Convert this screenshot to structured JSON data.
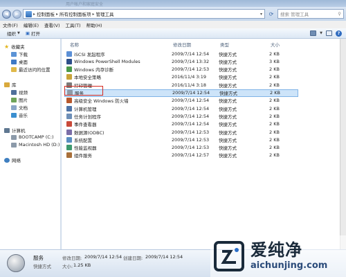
{
  "window": {
    "ghost_title": "用户帐户和家庭安全"
  },
  "address": {
    "crumbs": [
      "控制面板",
      "所有控制面板项",
      "管理工具"
    ],
    "search_placeholder": "搜索 管理工具"
  },
  "menu": [
    "文件(F)",
    "编辑(E)",
    "查看(V)",
    "工具(T)",
    "帮助(H)"
  ],
  "toolbar": {
    "organize": "组织",
    "open": "打开"
  },
  "nav": {
    "favorites": {
      "header": "收藏夹",
      "items": [
        "下载",
        "桌面",
        "最近访问的位置"
      ]
    },
    "libraries": {
      "header": "库",
      "items": [
        "视频",
        "图片",
        "文档",
        "音乐"
      ]
    },
    "computer": {
      "header": "计算机",
      "items": [
        "BOOTCAMP (C:)",
        "Macintosh HD (D:)"
      ]
    },
    "network": {
      "header": "网络"
    }
  },
  "columns": {
    "name": "名称",
    "date": "修改日期",
    "type": "类型",
    "size": "大小"
  },
  "files": [
    {
      "name": "iSCSI 发起程序",
      "date": "2009/7/14 12:54",
      "type": "快捷方式",
      "size": "2 KB",
      "icon": "iscsi-icon",
      "color": "#5b8fd6"
    },
    {
      "name": "Windows PowerShell Modules",
      "date": "2009/7/14 13:32",
      "type": "快捷方式",
      "size": "3 KB",
      "icon": "powershell-icon",
      "color": "#2d4f8a"
    },
    {
      "name": "Windows 内存诊断",
      "date": "2009/7/14 12:53",
      "type": "快捷方式",
      "size": "2 KB",
      "icon": "memory-diagnostic-icon",
      "color": "#4a9a4a"
    },
    {
      "name": "本地安全策略",
      "date": "2016/11/4 3:19",
      "type": "快捷方式",
      "size": "2 KB",
      "icon": "security-policy-icon",
      "color": "#c9a43a"
    },
    {
      "name": "打印管理",
      "date": "2016/11/4 3:18",
      "type": "快捷方式",
      "size": "2 KB",
      "icon": "print-management-icon",
      "color": "#7a7a7a"
    },
    {
      "name": "服务",
      "date": "2009/7/14 12:54",
      "type": "快捷方式",
      "size": "2 KB",
      "icon": "services-icon",
      "color": "#8f9aa6"
    },
    {
      "name": "高级安全 Windows 防火墙",
      "date": "2009/7/14 12:54",
      "type": "快捷方式",
      "size": "2 KB",
      "icon": "firewall-icon",
      "color": "#b8582c"
    },
    {
      "name": "计算机管理",
      "date": "2009/7/14 12:54",
      "type": "快捷方式",
      "size": "2 KB",
      "icon": "computer-management-icon",
      "color": "#4f74a8"
    },
    {
      "name": "任务计划程序",
      "date": "2009/7/14 12:54",
      "type": "快捷方式",
      "size": "2 KB",
      "icon": "task-scheduler-icon",
      "color": "#6d8fb8"
    },
    {
      "name": "事件查看器",
      "date": "2009/7/14 12:54",
      "type": "快捷方式",
      "size": "2 KB",
      "icon": "event-viewer-icon",
      "color": "#c94a3a"
    },
    {
      "name": "数据源(ODBC)",
      "date": "2009/7/14 12:53",
      "type": "快捷方式",
      "size": "2 KB",
      "icon": "odbc-icon",
      "color": "#7b6ea8"
    },
    {
      "name": "系统配置",
      "date": "2009/7/14 12:53",
      "type": "快捷方式",
      "size": "2 KB",
      "icon": "system-config-icon",
      "color": "#5a8fc2"
    },
    {
      "name": "性能监视器",
      "date": "2009/7/14 12:53",
      "type": "快捷方式",
      "size": "2 KB",
      "icon": "performance-monitor-icon",
      "color": "#3f9a6f"
    },
    {
      "name": "组件服务",
      "date": "2009/7/14 12:57",
      "type": "快捷方式",
      "size": "2 KB",
      "icon": "component-services-icon",
      "color": "#a86f3a"
    }
  ],
  "selected_index": 5,
  "details": {
    "name": "服务",
    "kind": "快捷方式",
    "modified_label": "修改日期:",
    "modified": "2009/7/14 12:54",
    "created_label": "创建日期:",
    "created": "2009/7/14 12:54",
    "size_label": "大小:",
    "size": "1.25 KB"
  },
  "watermark": {
    "brand": "爱纯净",
    "url": "aichunjing.com"
  }
}
